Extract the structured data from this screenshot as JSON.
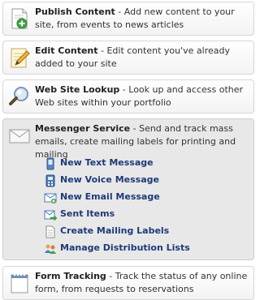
{
  "items": [
    {
      "title": "Publish Content",
      "desc": " - Add new content to your site, from events to news articles"
    },
    {
      "title": "Edit Content",
      "desc": " - Edit content you've already added to your site"
    },
    {
      "title": "Web Site Lookup",
      "desc": " - Look up and access other Web sites within your portfolio"
    },
    {
      "title": "Messenger Service",
      "desc": " - Send and track mass emails, create mailing labels for printing and mailing"
    },
    {
      "title": "Form Tracking",
      "desc": " - Track the status of any online form, from requests to reservations"
    }
  ],
  "messenger_links": [
    {
      "label": "New Text Message",
      "icon": "phone-icon"
    },
    {
      "label": "New Voice Message",
      "icon": "voice-icon"
    },
    {
      "label": "New Email Message",
      "icon": "email-icon"
    },
    {
      "label": "Sent Items",
      "icon": "sent-icon"
    },
    {
      "label": "Create Mailing Labels",
      "icon": "labels-icon"
    },
    {
      "label": "Manage Distribution Lists",
      "icon": "distribution-icon"
    }
  ]
}
